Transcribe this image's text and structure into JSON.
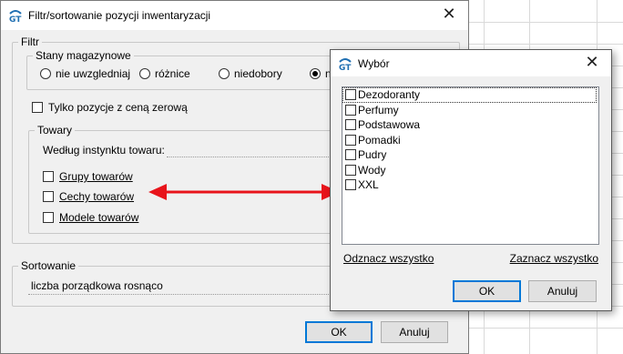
{
  "main_dialog": {
    "title": "Filtr/sortowanie pozycji inwentaryzacji",
    "filtr_legend": "Filtr",
    "stany_legend": "Stany magazynowe",
    "radios": [
      {
        "label": "nie uwzgledniaj",
        "selected": false
      },
      {
        "label": "różnice",
        "selected": false
      },
      {
        "label": "niedobory",
        "selected": false
      },
      {
        "label": "na",
        "selected": true
      }
    ],
    "zero_price_label": "Tylko pozycje z ceną zerową",
    "towary_legend": "Towary",
    "instinct_label": "Według instynktu towaru:",
    "towary_checks": [
      "Grupy towarów",
      "Cechy towarów",
      "Modele towarów"
    ],
    "sort_legend": "Sortowanie",
    "sort_value": "liczba porządkowa rosnąco",
    "ok_label": "OK",
    "cancel_label": "Anuluj"
  },
  "popup": {
    "title": "Wybór",
    "items": [
      "Dezodoranty",
      "Perfumy",
      "Podstawowa",
      "Pomadki",
      "Pudry",
      "Wody",
      "XXL"
    ],
    "unselect_all": "Odznacz wszystko",
    "select_all": "Zaznacz wszystko",
    "ok_label": "OK",
    "cancel_label": "Anuluj"
  },
  "colors": {
    "arrow": "#e8141b",
    "accent": "#0078d7"
  }
}
